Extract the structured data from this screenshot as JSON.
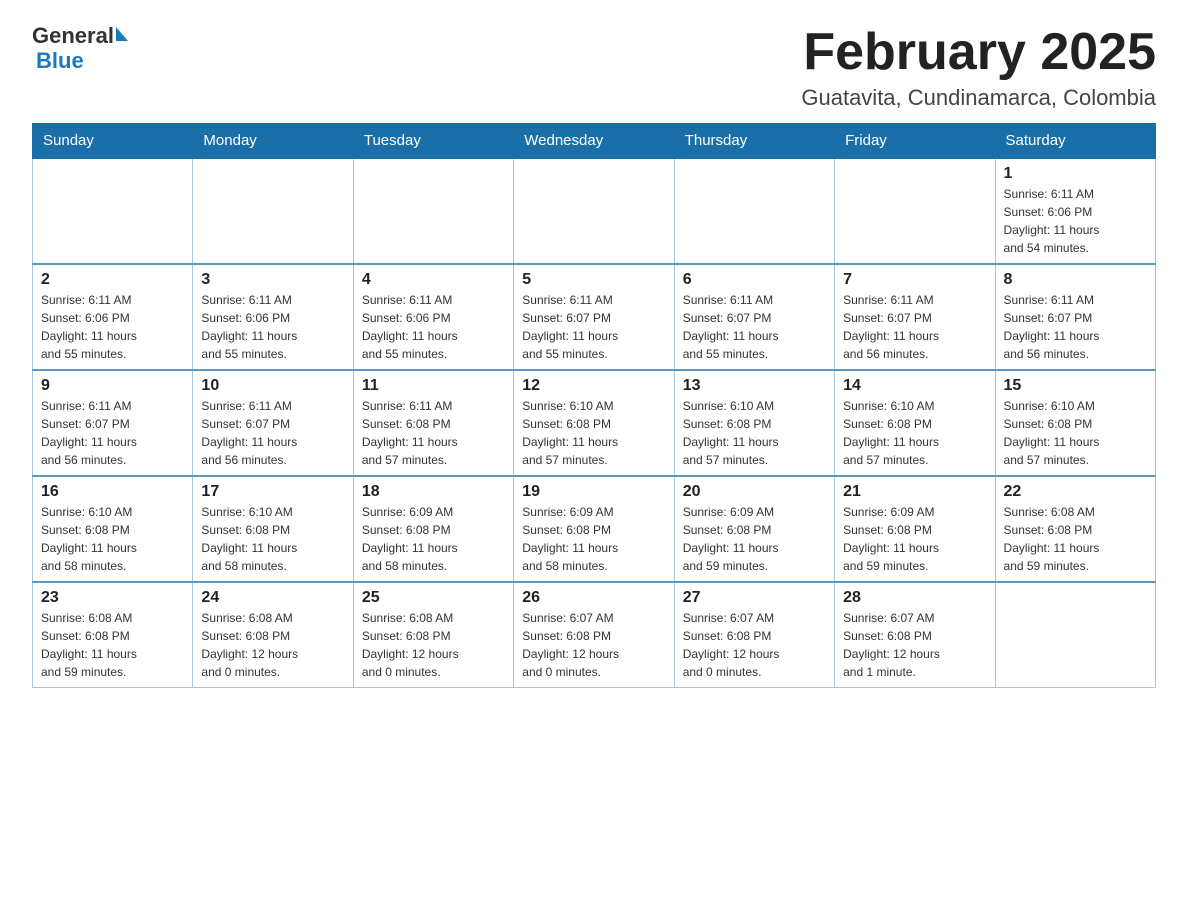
{
  "header": {
    "logo_general": "General",
    "logo_blue": "Blue",
    "title": "February 2025",
    "subtitle": "Guatavita, Cundinamarca, Colombia"
  },
  "weekdays": [
    "Sunday",
    "Monday",
    "Tuesday",
    "Wednesday",
    "Thursday",
    "Friday",
    "Saturday"
  ],
  "weeks": [
    [
      {
        "day": "",
        "info": ""
      },
      {
        "day": "",
        "info": ""
      },
      {
        "day": "",
        "info": ""
      },
      {
        "day": "",
        "info": ""
      },
      {
        "day": "",
        "info": ""
      },
      {
        "day": "",
        "info": ""
      },
      {
        "day": "1",
        "info": "Sunrise: 6:11 AM\nSunset: 6:06 PM\nDaylight: 11 hours\nand 54 minutes."
      }
    ],
    [
      {
        "day": "2",
        "info": "Sunrise: 6:11 AM\nSunset: 6:06 PM\nDaylight: 11 hours\nand 55 minutes."
      },
      {
        "day": "3",
        "info": "Sunrise: 6:11 AM\nSunset: 6:06 PM\nDaylight: 11 hours\nand 55 minutes."
      },
      {
        "day": "4",
        "info": "Sunrise: 6:11 AM\nSunset: 6:06 PM\nDaylight: 11 hours\nand 55 minutes."
      },
      {
        "day": "5",
        "info": "Sunrise: 6:11 AM\nSunset: 6:07 PM\nDaylight: 11 hours\nand 55 minutes."
      },
      {
        "day": "6",
        "info": "Sunrise: 6:11 AM\nSunset: 6:07 PM\nDaylight: 11 hours\nand 55 minutes."
      },
      {
        "day": "7",
        "info": "Sunrise: 6:11 AM\nSunset: 6:07 PM\nDaylight: 11 hours\nand 56 minutes."
      },
      {
        "day": "8",
        "info": "Sunrise: 6:11 AM\nSunset: 6:07 PM\nDaylight: 11 hours\nand 56 minutes."
      }
    ],
    [
      {
        "day": "9",
        "info": "Sunrise: 6:11 AM\nSunset: 6:07 PM\nDaylight: 11 hours\nand 56 minutes."
      },
      {
        "day": "10",
        "info": "Sunrise: 6:11 AM\nSunset: 6:07 PM\nDaylight: 11 hours\nand 56 minutes."
      },
      {
        "day": "11",
        "info": "Sunrise: 6:11 AM\nSunset: 6:08 PM\nDaylight: 11 hours\nand 57 minutes."
      },
      {
        "day": "12",
        "info": "Sunrise: 6:10 AM\nSunset: 6:08 PM\nDaylight: 11 hours\nand 57 minutes."
      },
      {
        "day": "13",
        "info": "Sunrise: 6:10 AM\nSunset: 6:08 PM\nDaylight: 11 hours\nand 57 minutes."
      },
      {
        "day": "14",
        "info": "Sunrise: 6:10 AM\nSunset: 6:08 PM\nDaylight: 11 hours\nand 57 minutes."
      },
      {
        "day": "15",
        "info": "Sunrise: 6:10 AM\nSunset: 6:08 PM\nDaylight: 11 hours\nand 57 minutes."
      }
    ],
    [
      {
        "day": "16",
        "info": "Sunrise: 6:10 AM\nSunset: 6:08 PM\nDaylight: 11 hours\nand 58 minutes."
      },
      {
        "day": "17",
        "info": "Sunrise: 6:10 AM\nSunset: 6:08 PM\nDaylight: 11 hours\nand 58 minutes."
      },
      {
        "day": "18",
        "info": "Sunrise: 6:09 AM\nSunset: 6:08 PM\nDaylight: 11 hours\nand 58 minutes."
      },
      {
        "day": "19",
        "info": "Sunrise: 6:09 AM\nSunset: 6:08 PM\nDaylight: 11 hours\nand 58 minutes."
      },
      {
        "day": "20",
        "info": "Sunrise: 6:09 AM\nSunset: 6:08 PM\nDaylight: 11 hours\nand 59 minutes."
      },
      {
        "day": "21",
        "info": "Sunrise: 6:09 AM\nSunset: 6:08 PM\nDaylight: 11 hours\nand 59 minutes."
      },
      {
        "day": "22",
        "info": "Sunrise: 6:08 AM\nSunset: 6:08 PM\nDaylight: 11 hours\nand 59 minutes."
      }
    ],
    [
      {
        "day": "23",
        "info": "Sunrise: 6:08 AM\nSunset: 6:08 PM\nDaylight: 11 hours\nand 59 minutes."
      },
      {
        "day": "24",
        "info": "Sunrise: 6:08 AM\nSunset: 6:08 PM\nDaylight: 12 hours\nand 0 minutes."
      },
      {
        "day": "25",
        "info": "Sunrise: 6:08 AM\nSunset: 6:08 PM\nDaylight: 12 hours\nand 0 minutes."
      },
      {
        "day": "26",
        "info": "Sunrise: 6:07 AM\nSunset: 6:08 PM\nDaylight: 12 hours\nand 0 minutes."
      },
      {
        "day": "27",
        "info": "Sunrise: 6:07 AM\nSunset: 6:08 PM\nDaylight: 12 hours\nand 0 minutes."
      },
      {
        "day": "28",
        "info": "Sunrise: 6:07 AM\nSunset: 6:08 PM\nDaylight: 12 hours\nand 1 minute."
      },
      {
        "day": "",
        "info": ""
      }
    ]
  ]
}
